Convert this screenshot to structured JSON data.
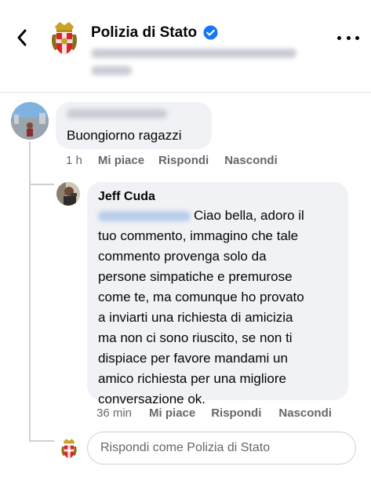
{
  "header": {
    "back_icon": "chevron-left-icon",
    "page_name": "Polizia di Stato",
    "verified_icon": "verified-badge-icon",
    "more_icon": "more-dots-icon"
  },
  "comment": {
    "text": "Buongiorno ragazzi",
    "time": "1 h",
    "like_label": "Mi piace",
    "reply_label": "Rispondi",
    "hide_label": "Nascondi"
  },
  "reply": {
    "author": "Jeff Cuda",
    "text_lines": [
      "Ciao bella, adoro il",
      "tuo commento, immagino che tale",
      "commento provenga solo da",
      "persone simpatiche e premurose",
      "come te, ma comunque ho provato",
      "a inviarti una richiesta di amicizia",
      "ma non ci sono riuscito, se non ti",
      "dispiace per favore mandami un",
      "amico  richiesta per una migliore",
      "conversazione ok."
    ],
    "time": "36 min",
    "like_label": "Mi piace",
    "reply_label": "Rispondi",
    "hide_label": "Nascondi"
  },
  "composer": {
    "placeholder": "Rispondi come Polizia di Stato"
  },
  "colors": {
    "verified": "#1877f2",
    "bubble": "#f0f2f5",
    "secondary_text": "#65676b"
  }
}
